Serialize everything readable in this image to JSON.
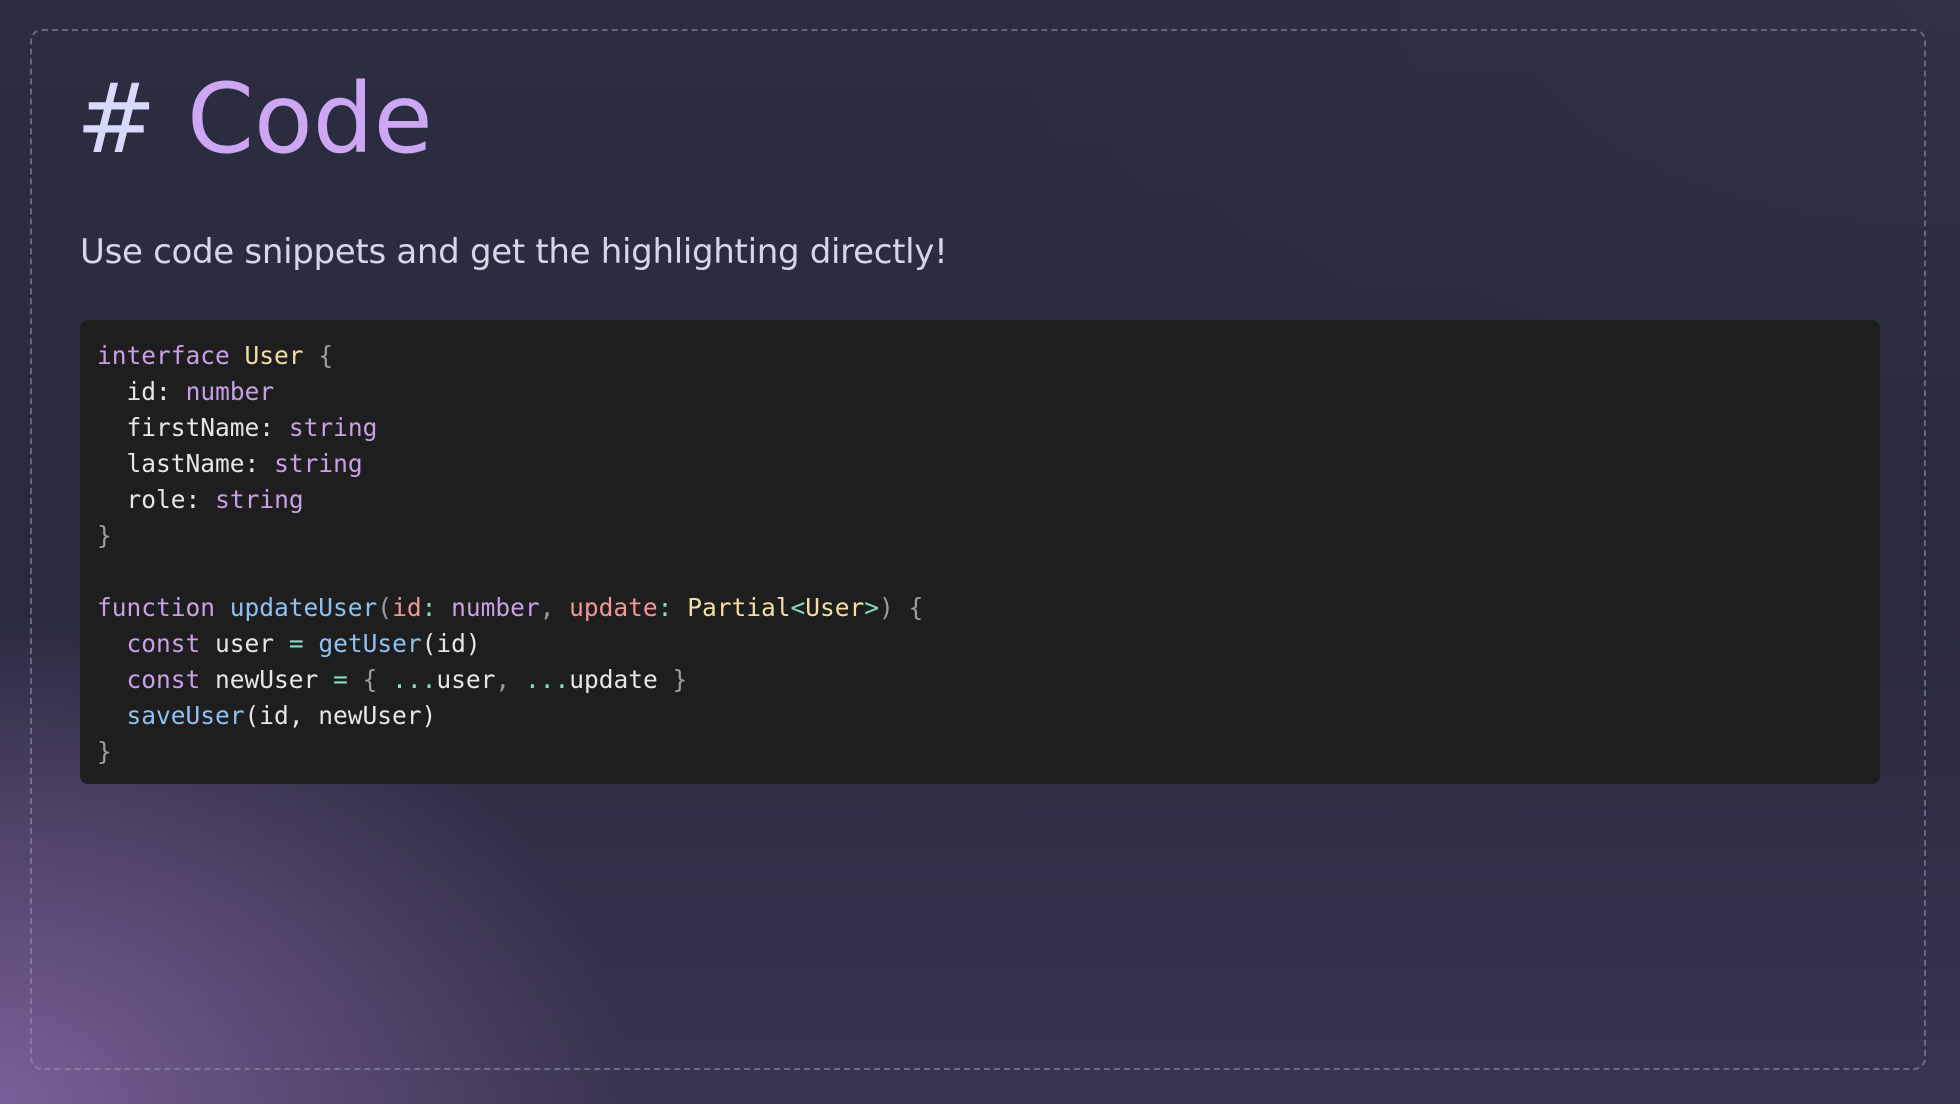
{
  "slide": {
    "title_hash": "#",
    "title_text": "Code",
    "subtitle": "Use code snippets and get the highlighting directly!"
  },
  "code": {
    "language": "typescript",
    "line1": {
      "kw": "interface",
      "name": "User",
      "brace": "{"
    },
    "line2": {
      "prop": "id",
      "colon": ":",
      "type": "number"
    },
    "line3": {
      "prop": "firstName",
      "colon": ":",
      "type": "string"
    },
    "line4": {
      "prop": "lastName",
      "colon": ":",
      "type": "string"
    },
    "line5": {
      "prop": "role",
      "colon": ":",
      "type": "string"
    },
    "line6": {
      "brace": "}"
    },
    "line8": {
      "kw": "function",
      "name": "updateUser",
      "open_paren": "(",
      "param1": "id",
      "colon1": ":",
      "type1": "number",
      "comma": ",",
      "param2": "update",
      "colon2": ":",
      "generic": "Partial",
      "lt": "<",
      "generic_arg": "User",
      "gt": ">",
      "close_paren": ")",
      "brace": "{"
    },
    "line9": {
      "kw": "const",
      "var": "user",
      "eq": "=",
      "call": "getUser",
      "args": "(id)"
    },
    "line10": {
      "kw": "const",
      "var": "newUser",
      "eq": "=",
      "open": "{",
      "spread1": "...",
      "ref1": "user",
      "comma": ",",
      "spread2": "...",
      "ref2": "update",
      "close": "}"
    },
    "line11": {
      "call": "saveUser",
      "args": "(id, newUser)"
    },
    "line12": {
      "brace": "}"
    }
  }
}
